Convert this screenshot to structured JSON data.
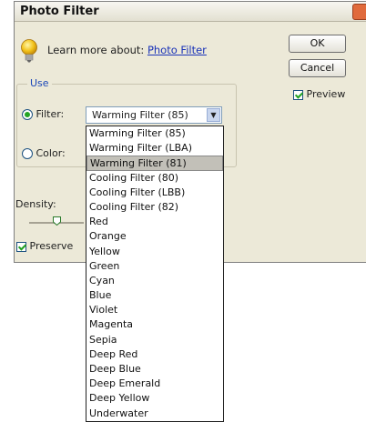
{
  "window": {
    "title": "Photo Filter"
  },
  "learn": {
    "prefix": "Learn more about:",
    "link": "Photo Filter"
  },
  "buttons": {
    "ok": "OK",
    "cancel": "Cancel"
  },
  "preview": {
    "label": "Preview",
    "checked": true
  },
  "use_group": {
    "legend": "Use",
    "filter_label": "Filter:",
    "color_label": "Color:",
    "selected_filter": "Warming Filter (85)"
  },
  "density": {
    "label": "Density:"
  },
  "preserve": {
    "label": "Preserve",
    "checked": true
  },
  "dropdown": {
    "selected_index": 2,
    "items": [
      "Warming Filter (85)",
      "Warming Filter (LBA)",
      "Warming Filter (81)",
      "Cooling Filter (80)",
      "Cooling Filter (LBB)",
      "Cooling Filter (82)",
      "Red",
      "Orange",
      "Yellow",
      "Green",
      "Cyan",
      "Blue",
      "Violet",
      "Magenta",
      "Sepia",
      "Deep Red",
      "Deep Blue",
      "Deep Emerald",
      "Deep Yellow",
      "Underwater"
    ]
  },
  "colors": {
    "legend": "#1a46b8",
    "link": "#1a33b8",
    "check": "#21a121"
  }
}
